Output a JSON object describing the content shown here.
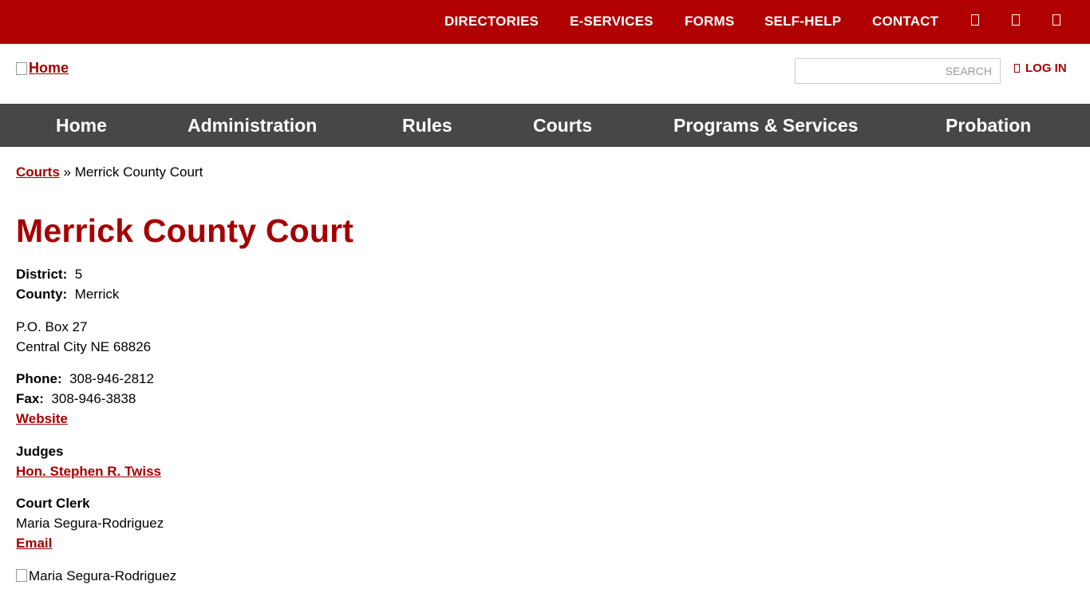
{
  "topbar": {
    "links": [
      "DIRECTORIES",
      "E-SERVICES",
      "FORMS",
      "SELF-HELP",
      "CONTACT"
    ],
    "icons": [
      "facebook-icon",
      "twitter-icon",
      "youtube-icon"
    ]
  },
  "header": {
    "logo_alt": "Home",
    "search_placeholder": "SEARCH",
    "login_label": "LOG IN"
  },
  "nav": {
    "items": [
      "Home",
      "Administration",
      "Rules",
      "Courts",
      "Programs & Services",
      "Probation"
    ]
  },
  "breadcrumb": {
    "parent": "Courts",
    "separator": "»",
    "current": "Merrick County Court"
  },
  "page": {
    "title": "Merrick County Court",
    "district_label": "District:",
    "district_value": "5",
    "county_label": "County:",
    "county_value": "Merrick",
    "address_line1": "P.O. Box 27",
    "address_line2": "Central City NE 68826",
    "phone_label": "Phone:",
    "phone_value": "308-946-2812",
    "fax_label": "Fax:",
    "fax_value": "308-946-3838",
    "website_link": "Website",
    "judges_heading": "Judges",
    "judge_name": "Hon. Stephen R. Twiss",
    "clerk_heading": "Court Clerk",
    "clerk_name": "Maria Segura-Rodriguez",
    "email_link": "Email",
    "clerk_image_alt": "Maria Segura-Rodriguez"
  },
  "colors": {
    "brand_red": "#b00000",
    "link_red": "#a50000",
    "nav_gray": "#474747"
  }
}
